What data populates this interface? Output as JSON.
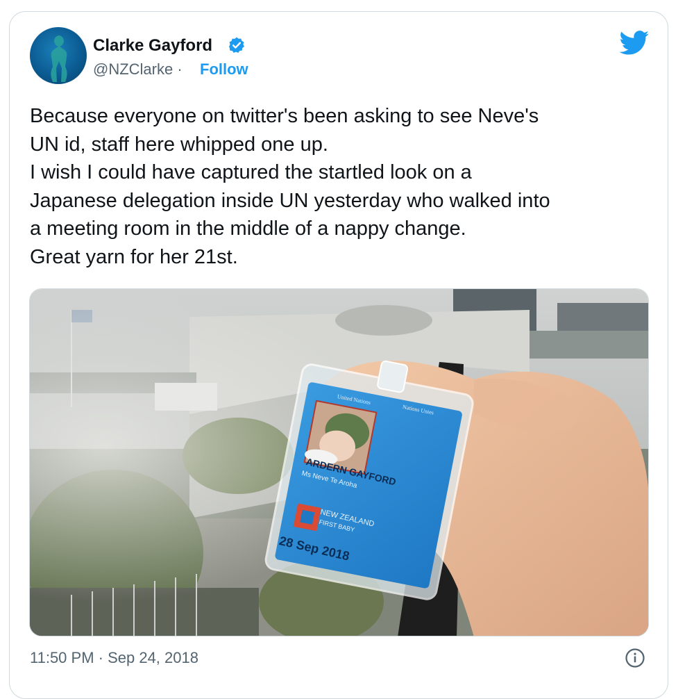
{
  "author": {
    "name": "Clarke Gayford",
    "handle": "@NZClarke",
    "separator": "·",
    "follow_label": "Follow"
  },
  "tweet": {
    "lines": [
      "Because everyone on twitter's been asking to see Neve's",
      "UN id, staff here whipped one up.",
      "I wish I could have captured the startled look on a",
      "Japanese delegation inside UN yesterday who walked into",
      "a meeting room in the middle of a nappy change.",
      "Great yarn for her 21st."
    ]
  },
  "photo": {
    "badge_header_left": "United Nations",
    "badge_header_right": "Nations Unies",
    "badge_surname": "ARDERN GAYFORD",
    "badge_given": "Ms Neve Te Aroha",
    "badge_country": "NEW ZEALAND",
    "badge_role": "FIRST BABY",
    "badge_date": "28 Sep 2018"
  },
  "footer": {
    "timestamp": "11:50 PM · Sep 24, 2018"
  },
  "icons": {
    "verified": "verified-badge-icon",
    "logo": "twitter-bird-icon",
    "info": "info-icon"
  },
  "colors": {
    "accent": "#1d9bf0",
    "text": "#0f1419",
    "muted": "#536471",
    "badge_blue": "#2f8fd8"
  }
}
